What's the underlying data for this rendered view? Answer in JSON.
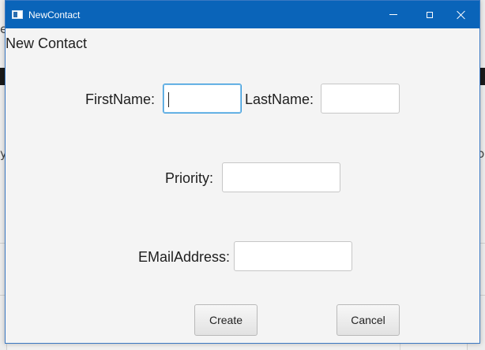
{
  "window": {
    "title": "NewContact"
  },
  "form": {
    "heading": "New Contact",
    "first_name": {
      "label": "FirstName:",
      "value": ""
    },
    "last_name": {
      "label": "LastName:",
      "value": ""
    },
    "priority": {
      "label": "Priority:",
      "value": ""
    },
    "email": {
      "label": "EMailAddress:",
      "value": ""
    }
  },
  "buttons": {
    "create": "Create",
    "cancel": "Cancel"
  },
  "background": {
    "left_glyph_1": "e",
    "left_glyph_2": "y",
    "right_glyph": "lo"
  },
  "colors": {
    "titlebar": "#0a64b9",
    "focus_border": "#3a9bdc"
  }
}
